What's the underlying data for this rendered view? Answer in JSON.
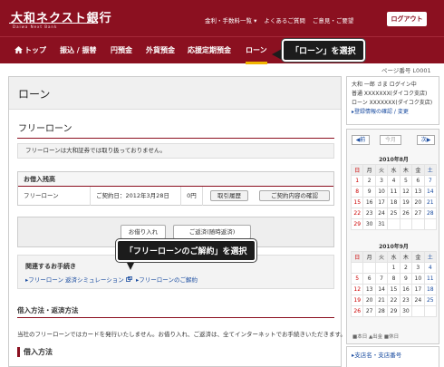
{
  "brand": {
    "name": "大和ネクスト銀行",
    "sub": "Daiwa Next Bank"
  },
  "header": {
    "links": [
      "金利・手数料一覧 ▾",
      "よくあるご質問",
      "ご意見・ご要望"
    ],
    "logout_label": "ログアウト"
  },
  "nav": {
    "items": [
      {
        "label": "トップ"
      },
      {
        "label": "振込 / 振替"
      },
      {
        "label": "円預金"
      },
      {
        "label": "外貨預金"
      },
      {
        "label": "応援定期預金"
      },
      {
        "label": "ローン"
      }
    ],
    "active": "ローン"
  },
  "callouts": {
    "loan": "「ローン」を選択",
    "contract": "「フリーローンのご解約」を選択"
  },
  "page_number": "ページ番号 L0001",
  "main": {
    "title": "ローン",
    "subtitle": "フリーローン",
    "note": "フリーローンは大和証券では取り扱っておりません。",
    "balance": {
      "header": "お借入残高",
      "product": "フリーローン",
      "contract_date": "ご契約日：2012年3月28日",
      "amount": "0円",
      "history_btn": "取引履歴",
      "confirm_btn": "ご契約内容の確認"
    },
    "actions": {
      "borrow": "お借り入れ",
      "repay": "ご返済(随時返済)"
    },
    "related": {
      "title": "関連するお手続き",
      "links": [
        "フリーローン 返済シミュレーション",
        "フリーローンのご解約"
      ]
    },
    "section1_title": "借入方法・返済方法",
    "section1_text": "当社のフリーローンではカードを発行いたしません。お借り入れ、ご返済は、全てインターネットでお手続きいただきます。",
    "section2_title": "借入方法"
  },
  "sidebar": {
    "user": {
      "line1": "大和 一郎 さま ログイン中",
      "line2": "普通 XXXXXXX(ダイコク支店)",
      "line3": "ローン XXXXXXX(ダイコク支店)",
      "link": "登録情報の確認 / 変更"
    },
    "calendar": {
      "prev": "◀前",
      "this_month": "今月",
      "next": "次▶",
      "months": [
        {
          "title": "2010年8月",
          "weekdays": [
            "日",
            "月",
            "火",
            "水",
            "木",
            "金",
            "土"
          ],
          "weeks": [
            [
              "1",
              "2",
              "3",
              "4",
              "5",
              "6",
              "7"
            ],
            [
              "8",
              "9",
              "10",
              "11",
              "12",
              "13",
              "14"
            ],
            [
              "15",
              "16",
              "17",
              "18",
              "19",
              "20",
              "21"
            ],
            [
              "22",
              "23",
              "24",
              "25",
              "26",
              "27",
              "28"
            ],
            [
              "29",
              "30",
              "31",
              "",
              "",
              "",
              ""
            ]
          ]
        },
        {
          "title": "2010年9月",
          "weekdays": [
            "日",
            "月",
            "火",
            "水",
            "木",
            "金",
            "土"
          ],
          "weeks": [
            [
              "",
              "",
              "",
              "1",
              "2",
              "3",
              "4"
            ],
            [
              "5",
              "6",
              "7",
              "8",
              "9",
              "10",
              "11"
            ],
            [
              "12",
              "13",
              "14",
              "15",
              "16",
              "17",
              "18"
            ],
            [
              "19",
              "20",
              "21",
              "22",
              "23",
              "24",
              "25"
            ],
            [
              "26",
              "27",
              "28",
              "29",
              "30",
              "",
              ""
            ]
          ]
        }
      ],
      "legend": "■本日 ▲出金 ■休日"
    },
    "branch": "支店名・支店番号"
  },
  "colors": {
    "brand": "#8b1020",
    "accent": "#f0b400",
    "link": "#1a4ca0"
  }
}
